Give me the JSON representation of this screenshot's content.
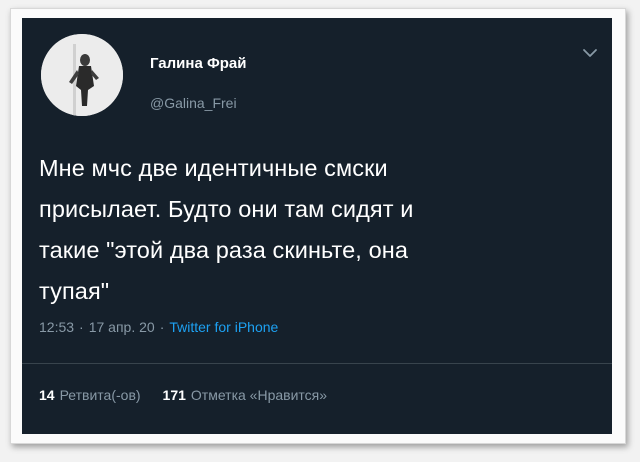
{
  "user": {
    "name": "Галина Фрай",
    "handle": "@Galina_Frei",
    "avatar_icon": "avatar-photo"
  },
  "tweet": {
    "text": "Мне мчс две идентичные смски\nприсылает. Будто они там сидят и\nтакие \"этой два раза скиньте, она\nтупая\"",
    "time": "12:53",
    "date": "17 апр. 20",
    "source": "Twitter for iPhone"
  },
  "stats": {
    "retweets_count": "14",
    "retweets_label": "Ретвита(-ов)",
    "likes_count": "171",
    "likes_label": "Отметка «Нравится»"
  },
  "menu_icon": "chevron-down-icon",
  "colors": {
    "background": "#15202b",
    "text": "#ffffff",
    "muted": "#8899a6",
    "link": "#1da1f2"
  }
}
